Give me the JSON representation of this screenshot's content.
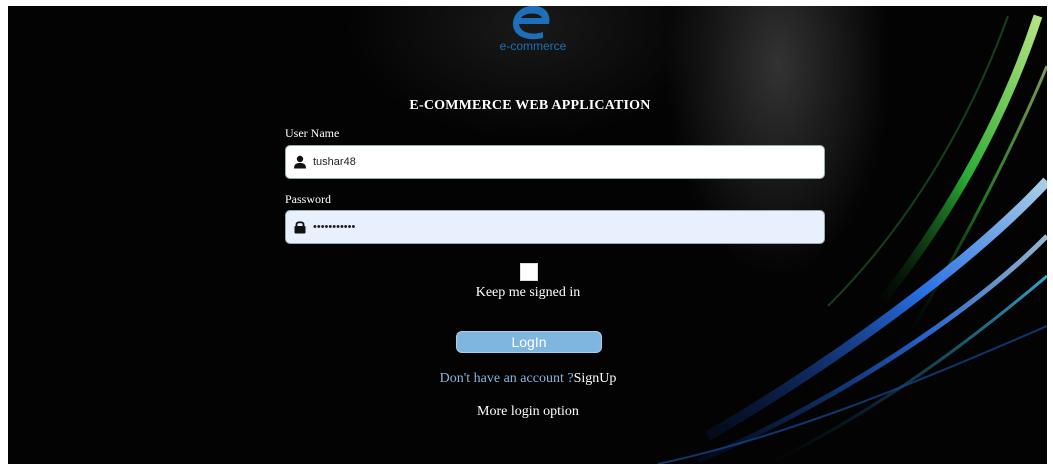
{
  "logo": {
    "text": "e-commerce",
    "icon": "e-logo-icon"
  },
  "title": "E-COMMERCE WEB APPLICATION",
  "username": {
    "label": "User Name",
    "value": "tushar48",
    "icon": "user-icon"
  },
  "password": {
    "label": "Password",
    "value": "•••••••••••",
    "icon": "lock-icon"
  },
  "keep_signed_in": {
    "label": "Keep me signed in",
    "checked": false
  },
  "login_button": "LogIn",
  "signup": {
    "question": "Don't have an account ?",
    "link": "SignUp"
  },
  "more_login": "More login option",
  "colors": {
    "background": "#030303",
    "button": "#7fb6e0",
    "link_question": "#8ab4d8",
    "logo": "#1f6fb8"
  }
}
